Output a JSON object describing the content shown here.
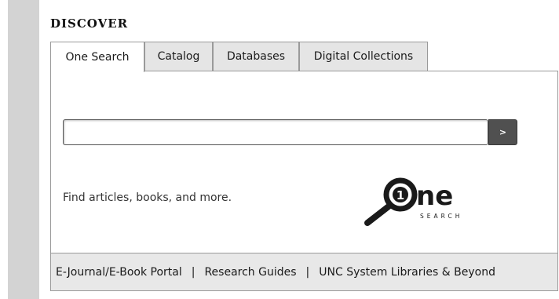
{
  "discover": {
    "heading": "DISCOVER",
    "tabs": [
      {
        "label": "One Search",
        "active": true
      },
      {
        "label": "Catalog",
        "active": false
      },
      {
        "label": "Databases",
        "active": false
      },
      {
        "label": "Digital Collections",
        "active": false
      }
    ],
    "search": {
      "value": "",
      "button_label": ">"
    },
    "helper_text": "Find articles, books, and more.",
    "logo": {
      "numeral": "1",
      "word": "ne",
      "subtitle": "SEARCH"
    },
    "footer": {
      "links": [
        "E-Journal/E-Book Portal",
        "Research Guides",
        "UNC System Libraries & Beyond"
      ],
      "separator": "|"
    },
    "colors": {
      "left_bar": "#d3d3d3",
      "tab_inactive": "#e5e5e5",
      "footer_bg": "#e8e8e8",
      "button_bg": "#505050"
    }
  }
}
